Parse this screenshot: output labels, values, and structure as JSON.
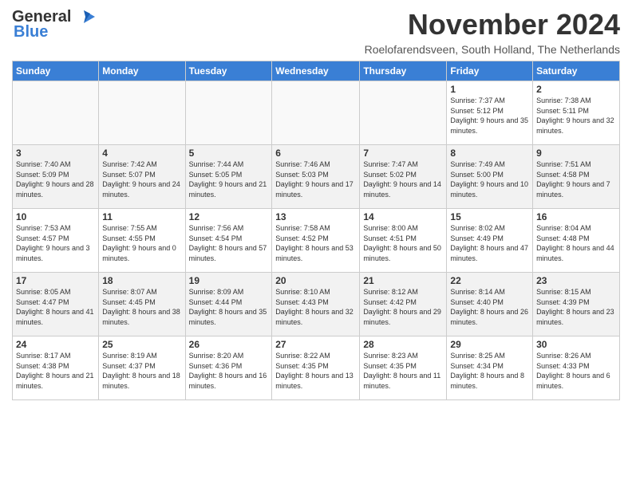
{
  "header": {
    "logo_general": "General",
    "logo_blue": "Blue",
    "title": "November 2024",
    "location": "Roelofarendsveen, South Holland, The Netherlands"
  },
  "weekdays": [
    "Sunday",
    "Monday",
    "Tuesday",
    "Wednesday",
    "Thursday",
    "Friday",
    "Saturday"
  ],
  "weeks": [
    [
      {
        "day": "",
        "info": ""
      },
      {
        "day": "",
        "info": ""
      },
      {
        "day": "",
        "info": ""
      },
      {
        "day": "",
        "info": ""
      },
      {
        "day": "",
        "info": ""
      },
      {
        "day": "1",
        "info": "Sunrise: 7:37 AM\nSunset: 5:12 PM\nDaylight: 9 hours and 35 minutes."
      },
      {
        "day": "2",
        "info": "Sunrise: 7:38 AM\nSunset: 5:11 PM\nDaylight: 9 hours and 32 minutes."
      }
    ],
    [
      {
        "day": "3",
        "info": "Sunrise: 7:40 AM\nSunset: 5:09 PM\nDaylight: 9 hours and 28 minutes."
      },
      {
        "day": "4",
        "info": "Sunrise: 7:42 AM\nSunset: 5:07 PM\nDaylight: 9 hours and 24 minutes."
      },
      {
        "day": "5",
        "info": "Sunrise: 7:44 AM\nSunset: 5:05 PM\nDaylight: 9 hours and 21 minutes."
      },
      {
        "day": "6",
        "info": "Sunrise: 7:46 AM\nSunset: 5:03 PM\nDaylight: 9 hours and 17 minutes."
      },
      {
        "day": "7",
        "info": "Sunrise: 7:47 AM\nSunset: 5:02 PM\nDaylight: 9 hours and 14 minutes."
      },
      {
        "day": "8",
        "info": "Sunrise: 7:49 AM\nSunset: 5:00 PM\nDaylight: 9 hours and 10 minutes."
      },
      {
        "day": "9",
        "info": "Sunrise: 7:51 AM\nSunset: 4:58 PM\nDaylight: 9 hours and 7 minutes."
      }
    ],
    [
      {
        "day": "10",
        "info": "Sunrise: 7:53 AM\nSunset: 4:57 PM\nDaylight: 9 hours and 3 minutes."
      },
      {
        "day": "11",
        "info": "Sunrise: 7:55 AM\nSunset: 4:55 PM\nDaylight: 9 hours and 0 minutes."
      },
      {
        "day": "12",
        "info": "Sunrise: 7:56 AM\nSunset: 4:54 PM\nDaylight: 8 hours and 57 minutes."
      },
      {
        "day": "13",
        "info": "Sunrise: 7:58 AM\nSunset: 4:52 PM\nDaylight: 8 hours and 53 minutes."
      },
      {
        "day": "14",
        "info": "Sunrise: 8:00 AM\nSunset: 4:51 PM\nDaylight: 8 hours and 50 minutes."
      },
      {
        "day": "15",
        "info": "Sunrise: 8:02 AM\nSunset: 4:49 PM\nDaylight: 8 hours and 47 minutes."
      },
      {
        "day": "16",
        "info": "Sunrise: 8:04 AM\nSunset: 4:48 PM\nDaylight: 8 hours and 44 minutes."
      }
    ],
    [
      {
        "day": "17",
        "info": "Sunrise: 8:05 AM\nSunset: 4:47 PM\nDaylight: 8 hours and 41 minutes."
      },
      {
        "day": "18",
        "info": "Sunrise: 8:07 AM\nSunset: 4:45 PM\nDaylight: 8 hours and 38 minutes."
      },
      {
        "day": "19",
        "info": "Sunrise: 8:09 AM\nSunset: 4:44 PM\nDaylight: 8 hours and 35 minutes."
      },
      {
        "day": "20",
        "info": "Sunrise: 8:10 AM\nSunset: 4:43 PM\nDaylight: 8 hours and 32 minutes."
      },
      {
        "day": "21",
        "info": "Sunrise: 8:12 AM\nSunset: 4:42 PM\nDaylight: 8 hours and 29 minutes."
      },
      {
        "day": "22",
        "info": "Sunrise: 8:14 AM\nSunset: 4:40 PM\nDaylight: 8 hours and 26 minutes."
      },
      {
        "day": "23",
        "info": "Sunrise: 8:15 AM\nSunset: 4:39 PM\nDaylight: 8 hours and 23 minutes."
      }
    ],
    [
      {
        "day": "24",
        "info": "Sunrise: 8:17 AM\nSunset: 4:38 PM\nDaylight: 8 hours and 21 minutes."
      },
      {
        "day": "25",
        "info": "Sunrise: 8:19 AM\nSunset: 4:37 PM\nDaylight: 8 hours and 18 minutes."
      },
      {
        "day": "26",
        "info": "Sunrise: 8:20 AM\nSunset: 4:36 PM\nDaylight: 8 hours and 16 minutes."
      },
      {
        "day": "27",
        "info": "Sunrise: 8:22 AM\nSunset: 4:35 PM\nDaylight: 8 hours and 13 minutes."
      },
      {
        "day": "28",
        "info": "Sunrise: 8:23 AM\nSunset: 4:35 PM\nDaylight: 8 hours and 11 minutes."
      },
      {
        "day": "29",
        "info": "Sunrise: 8:25 AM\nSunset: 4:34 PM\nDaylight: 8 hours and 8 minutes."
      },
      {
        "day": "30",
        "info": "Sunrise: 8:26 AM\nSunset: 4:33 PM\nDaylight: 8 hours and 6 minutes."
      }
    ]
  ]
}
